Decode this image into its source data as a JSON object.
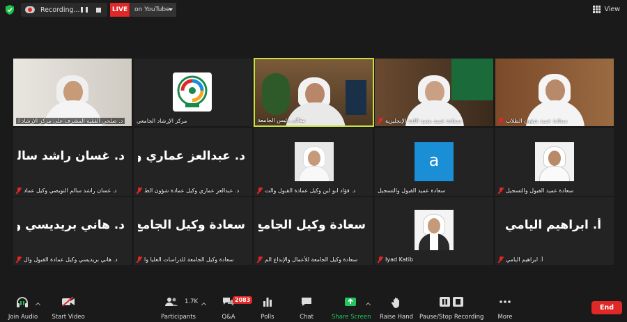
{
  "top_bar": {
    "recording_label": "Recording...",
    "live_label": "LIVE",
    "stream_label": "on YouTube",
    "view_label": "View"
  },
  "tiles": [
    {
      "name": "د. صلحي الفقيه المشرف على مركز الإرشاد ا",
      "big": ""
    },
    {
      "name": "مركز الإرشاد الجامعي",
      "big": ""
    },
    {
      "name": "معالي رئيس الجامعة",
      "big": ""
    },
    {
      "name": "سعادة عميد معهد اللغة الإنجليزية",
      "big": ""
    },
    {
      "name": "سعادة عميد شؤون الطلاب",
      "big": ""
    },
    {
      "name": "د. غسان راشد سالم النويصي وكيل عماد",
      "big": "د. غسان راشد سالم"
    },
    {
      "name": "د. عبدالعز عماري وكيل عمادة شؤون الط",
      "big": "د. عبدالعز عماري و"
    },
    {
      "name": "د. فؤاد ابو لبن وكيل عمادة القبول والت",
      "big": ""
    },
    {
      "name": "سعادة عميد القبول والتسجيل",
      "big": ""
    },
    {
      "name": "سعادة عميد القبول والتسجيل",
      "big": ""
    },
    {
      "name": "د. هاني بريديسي وكيل عمادة القبول وال",
      "big": "د. هاني بريديسي وك"
    },
    {
      "name": "سعادة وكيل الجامعة للدراسات العليا وا",
      "big": "سعادة وكيل الجامع"
    },
    {
      "name": "سعادة وكيل الجامعة للأعمال والإبداع الم",
      "big": "سعادة وكيل الجامع"
    },
    {
      "name": "Iyad Katib",
      "big": ""
    },
    {
      "name": "أ. ابراهيم اليامي",
      "big": "أ. ابراهيم اليامي"
    }
  ],
  "avatar_letter": "a",
  "toolbar": {
    "join_audio": "Join Audio",
    "start_video": "Start Video",
    "participants": "Participants",
    "participants_count": "1.7K",
    "qa": "Q&A",
    "qa_badge": "2083",
    "polls": "Polls",
    "chat": "Chat",
    "share_screen": "Share Screen",
    "raise_hand": "Raise Hand",
    "pause_stop": "Pause/Stop Recording",
    "more": "More",
    "end": "End"
  },
  "colors": {
    "active_speaker": "#c6e23e",
    "live_red": "#e02828",
    "share_green": "#22c55e",
    "avatar_blue": "#1a8fd6"
  }
}
